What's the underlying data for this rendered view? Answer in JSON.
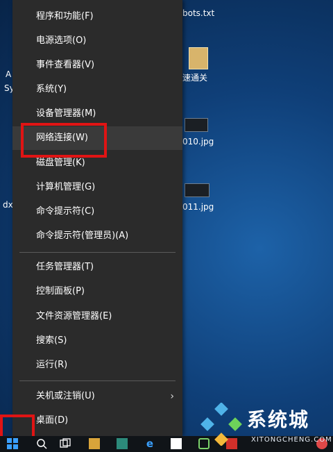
{
  "desktop": {
    "icons": [
      {
        "label": "bots.txt"
      },
      {
        "label": "速通关"
      },
      {
        "label": "010.jpg"
      },
      {
        "label": "011.jpg"
      }
    ],
    "partial_labels": [
      "A",
      "Sy",
      "dx"
    ]
  },
  "context_menu": {
    "group1": [
      {
        "label": "程序和功能(F)"
      },
      {
        "label": "电源选项(O)"
      },
      {
        "label": "事件查看器(V)"
      },
      {
        "label": "系统(Y)"
      },
      {
        "label": "设备管理器(M)"
      },
      {
        "label": "网络连接(W)"
      },
      {
        "label": "磁盘管理(K)"
      },
      {
        "label": "计算机管理(G)"
      },
      {
        "label": "命令提示符(C)"
      },
      {
        "label": "命令提示符(管理员)(A)"
      }
    ],
    "group2": [
      {
        "label": "任务管理器(T)"
      },
      {
        "label": "控制面板(P)"
      },
      {
        "label": "文件资源管理器(E)"
      },
      {
        "label": "搜索(S)"
      },
      {
        "label": "运行(R)"
      }
    ],
    "group3": [
      {
        "label": "关机或注销(U)",
        "has_submenu": true
      },
      {
        "label": "桌面(D)"
      }
    ],
    "highlighted_item": "网络连接(W)"
  },
  "watermark": {
    "text": "系统城",
    "url": "XITONGCHENG.COM"
  },
  "colors": {
    "menu_bg": "#2b2b2b",
    "highlight_border": "#e01414",
    "taskbar": "#101418"
  }
}
